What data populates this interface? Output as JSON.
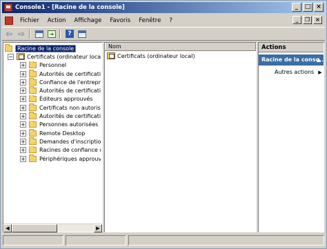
{
  "window": {
    "title": "Console1 - [Racine de la console]",
    "title_buttons": [
      "_",
      "□",
      "×"
    ],
    "mdi_buttons": [
      "_",
      "❐",
      "×"
    ]
  },
  "menu": {
    "items": [
      "Fichier",
      "Action",
      "Affichage",
      "Favoris",
      "Fenêtre",
      "?"
    ]
  },
  "toolbar": {
    "back_icon": "back-arrow-icon",
    "forward_icon": "forward-arrow-icon",
    "help_label": "?"
  },
  "tree": {
    "root": "Racine de la console",
    "cert_node": "Certificats (ordinateur local)",
    "children": [
      "Personnel",
      "Autorités de certification",
      "Confiance de l'entreprise",
      "Autorités de certification",
      "Éditeurs approuvés",
      "Certificats non autorisés",
      "Autorités de certification",
      "Personnes autorisées",
      "Remote Desktop",
      "Demandes d'inscription de",
      "Racines de confiance de c",
      "Périphériques approuvés"
    ]
  },
  "list": {
    "column_name": "Nom",
    "rows": [
      "Certificats (ordinateur local)"
    ]
  },
  "actions": {
    "title": "Actions",
    "section": "Racine de la conso...",
    "more_actions": "Autres actions"
  },
  "colors": {
    "title_bar_start": "#0a246a",
    "title_bar_end": "#a6caf0",
    "selection": "#0a246a",
    "actions_header": "#3a6ea5"
  }
}
